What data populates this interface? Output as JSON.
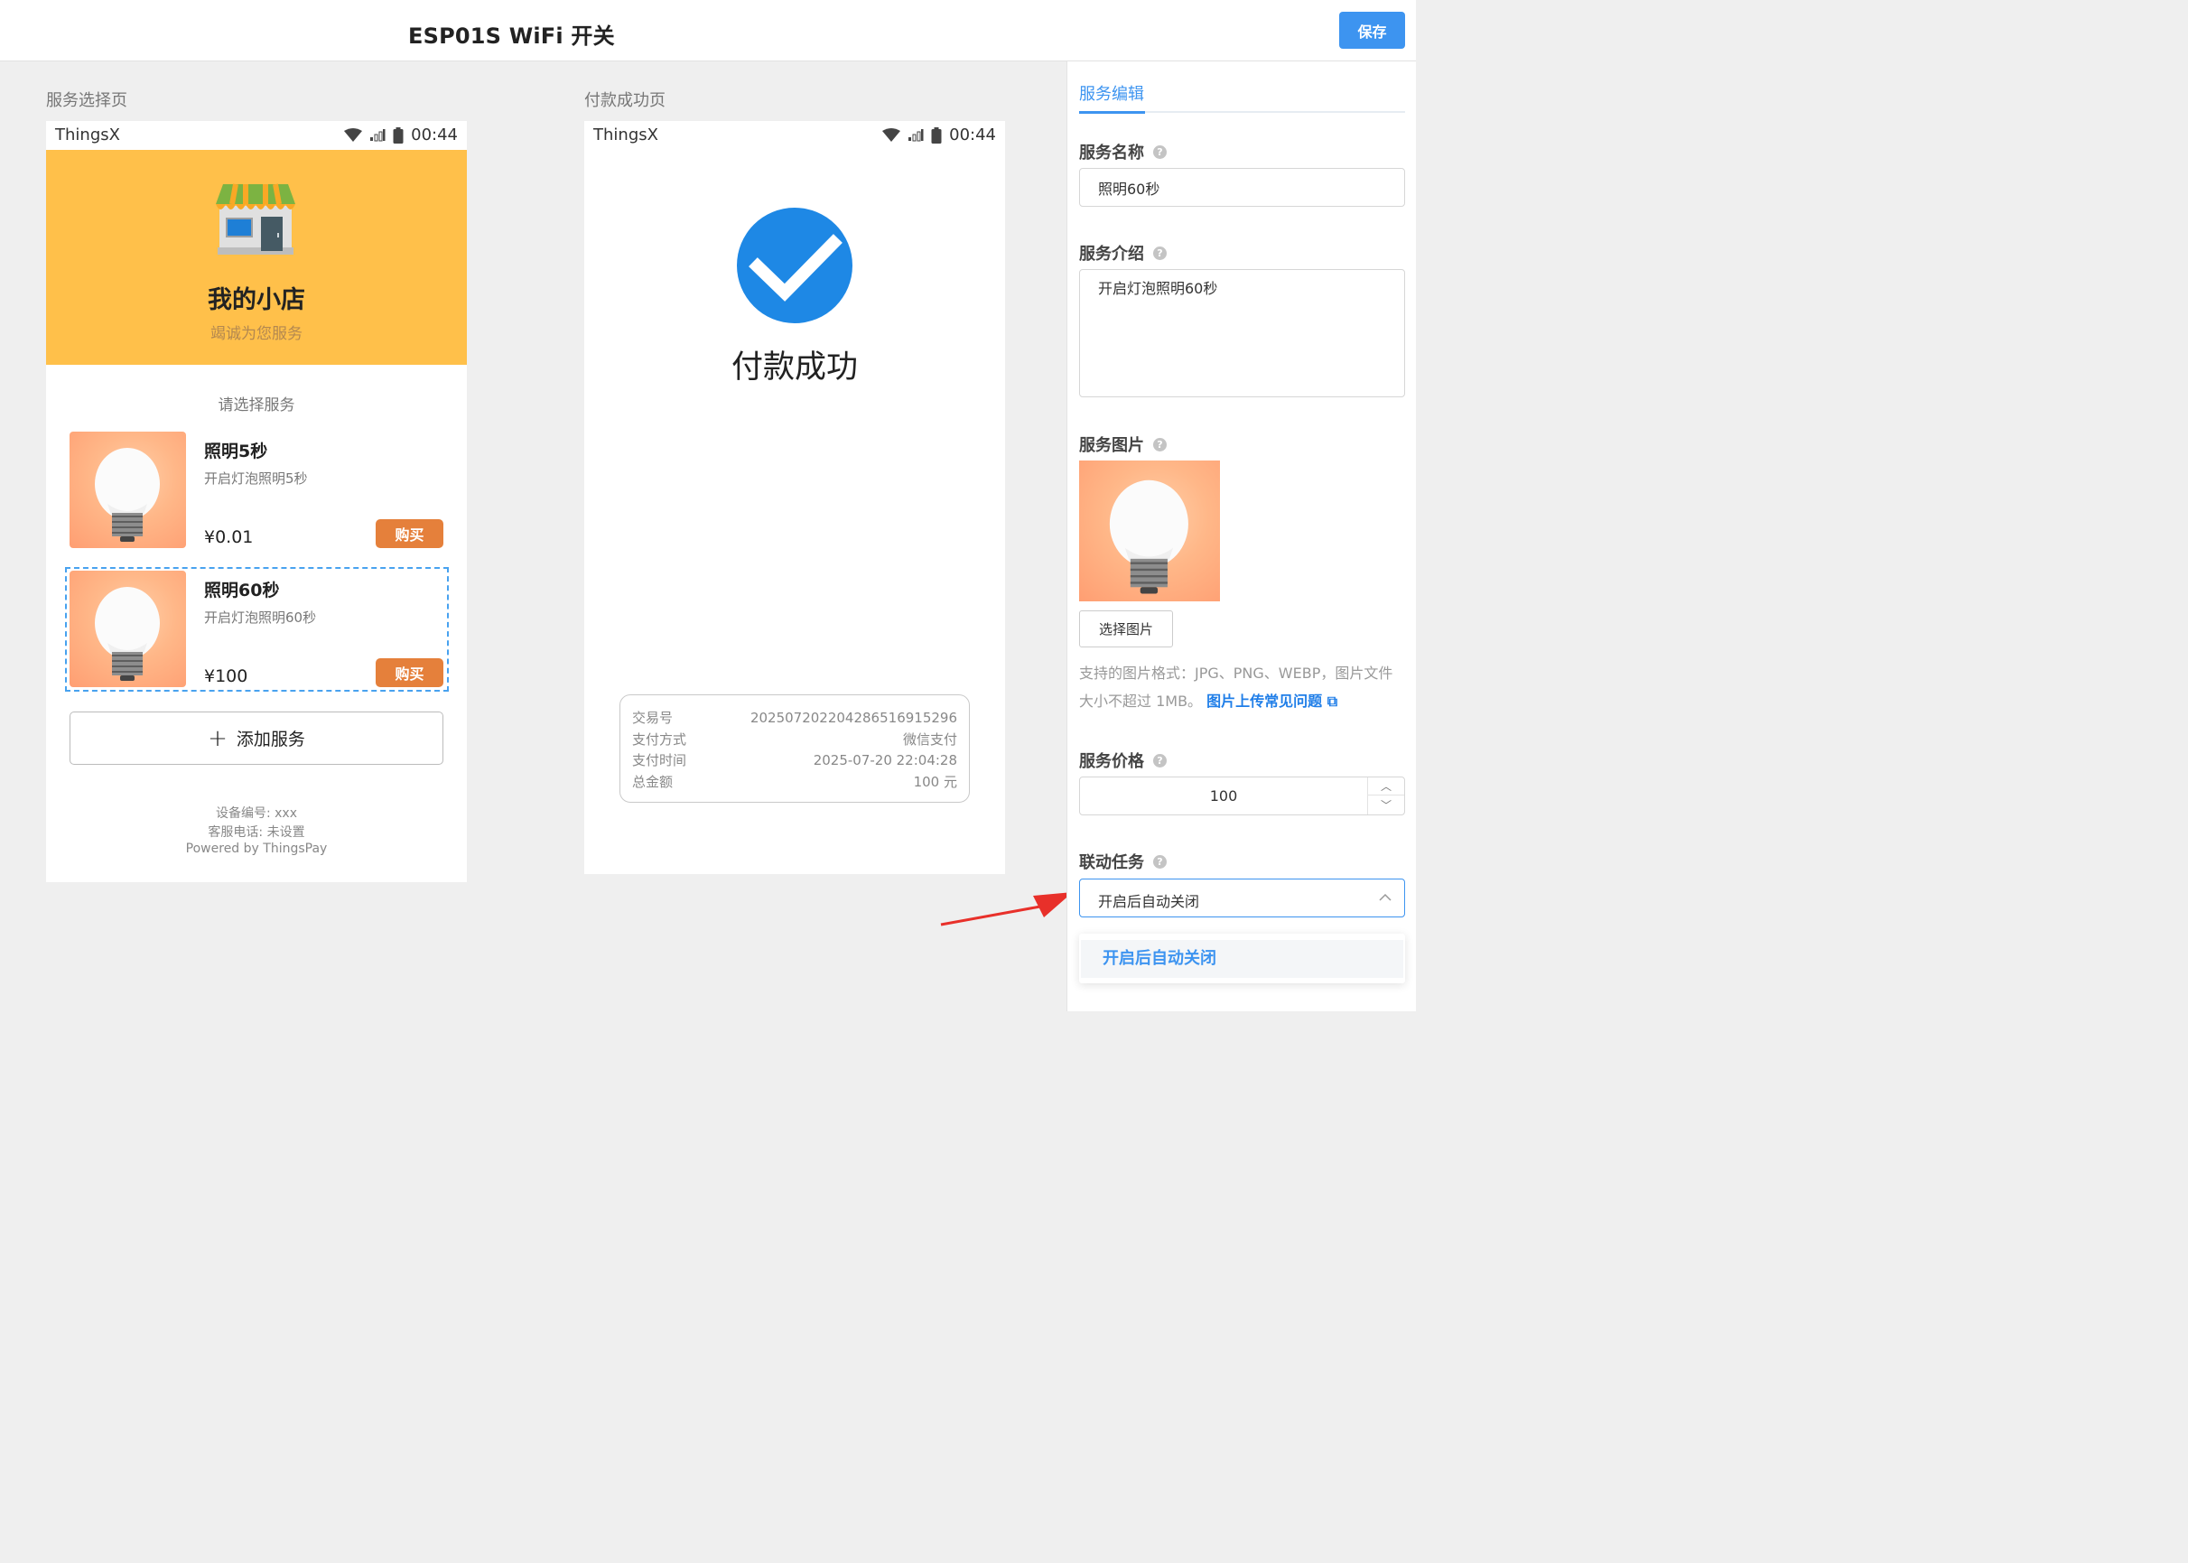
{
  "header": {
    "title": "ESP01S WiFi 开关",
    "save_label": "保存"
  },
  "captions": {
    "service_page": "服务选择页",
    "success_page": "付款成功页"
  },
  "status_bar": {
    "carrier": "ThingsX",
    "time": "00:44"
  },
  "store": {
    "name": "我的小店",
    "subtitle": "竭诚为您服务",
    "choose_title": "请选择服务"
  },
  "services": [
    {
      "name": "照明5秒",
      "desc": "开启灯泡照明5秒",
      "price": "¥0.01",
      "buy_label": "购买"
    },
    {
      "name": "照明60秒",
      "desc": "开启灯泡照明60秒",
      "price": "¥100",
      "buy_label": "购买"
    }
  ],
  "add_service_label": "添加服务",
  "footer": {
    "device": "设备编号: xxx",
    "phone": "客服电话: 未设置",
    "powered": "Powered by ThingsPay"
  },
  "success": {
    "title": "付款成功",
    "rows": [
      {
        "label": "交易号",
        "value": "20250720220428651691529​6"
      },
      {
        "label": "支付方式",
        "value": "微信支付"
      },
      {
        "label": "支付时间",
        "value": "2025-07-20 22:04:28"
      },
      {
        "label": "总金额",
        "value": "100 元"
      }
    ]
  },
  "editor": {
    "tab_label": "服务编辑",
    "name_label": "服务名称",
    "name_value": "照明60秒",
    "intro_label": "服务介绍",
    "intro_value": "开启灯泡照明60秒",
    "image_label": "服务图片",
    "pick_image_label": "选择图片",
    "image_hint": "支持的图片格式：JPG、PNG、WEBP，图片文件大小不超过 1MB。",
    "image_faq_link": "图片上传常见问题",
    "price_label": "服务价格",
    "price_value": "100",
    "task_label": "联动任务",
    "task_value": "开启后自动关闭",
    "task_options": [
      "开启后自动关闭"
    ]
  },
  "colors": {
    "accent": "#3d94f0",
    "store_header": "#ffc04a",
    "buy_button": "#e5803b",
    "success": "#1e88e5",
    "arrow": "#e8302a"
  }
}
